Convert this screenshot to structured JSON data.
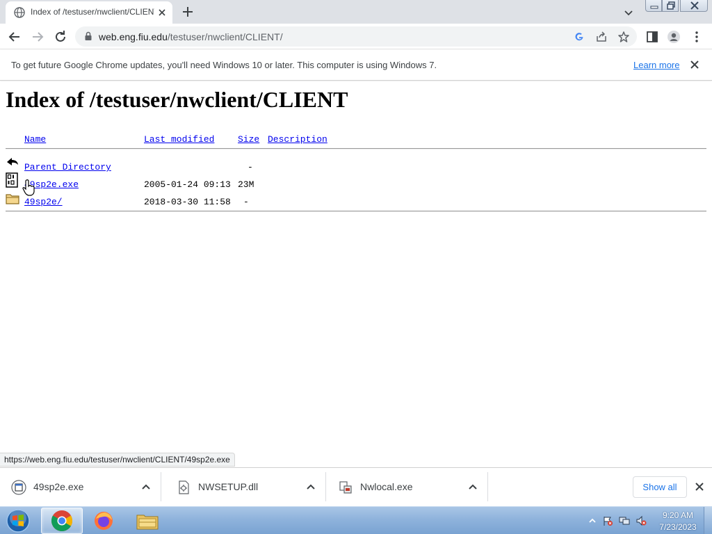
{
  "browser": {
    "tab_title": "Index of /testuser/nwclient/CLIENT/",
    "url_host": "web.eng.fiu.edu",
    "url_path": "/testuser/nwclient/CLIENT/"
  },
  "infobar": {
    "message": "To get future Google Chrome updates, you'll need Windows 10 or later. This computer is using Windows 7.",
    "link_label": "Learn more"
  },
  "page": {
    "title": "Index of /testuser/nwclient/CLIENT",
    "headers": {
      "name": "Name",
      "last_modified": "Last modified",
      "size": "Size",
      "description": "Description"
    },
    "rows": [
      {
        "icon": "back-icon",
        "name": "Parent Directory",
        "modified": "",
        "size": "-"
      },
      {
        "icon": "binary-file-icon",
        "name": "49sp2e.exe",
        "modified": "2005-01-24 09:13",
        "size": "23M"
      },
      {
        "icon": "folder-icon",
        "name": "49sp2e/",
        "modified": "2018-03-30 11:58",
        "size": "-"
      }
    ]
  },
  "status_bar": {
    "url": "https://web.eng.fiu.edu/testuser/nwclient/CLIENT/49sp2e.exe"
  },
  "downloads": {
    "items": [
      {
        "name": "49sp2e.exe",
        "icon": "exe-file-icon"
      },
      {
        "name": "NWSETUP.dll",
        "icon": "dll-file-icon"
      },
      {
        "name": "Nwlocal.exe",
        "icon": "exe-file-icon"
      }
    ],
    "show_all_label": "Show all"
  },
  "taskbar": {
    "time": "9:20 AM",
    "date": "7/23/2023",
    "apps": [
      "chrome-icon",
      "firefox-icon",
      "file-explorer-icon"
    ]
  },
  "colors": {
    "link": "#0000ee",
    "chrome_accent": "#1a73e8",
    "tabstrip": "#dee1e6",
    "taskbar": "#8fb3dc"
  }
}
